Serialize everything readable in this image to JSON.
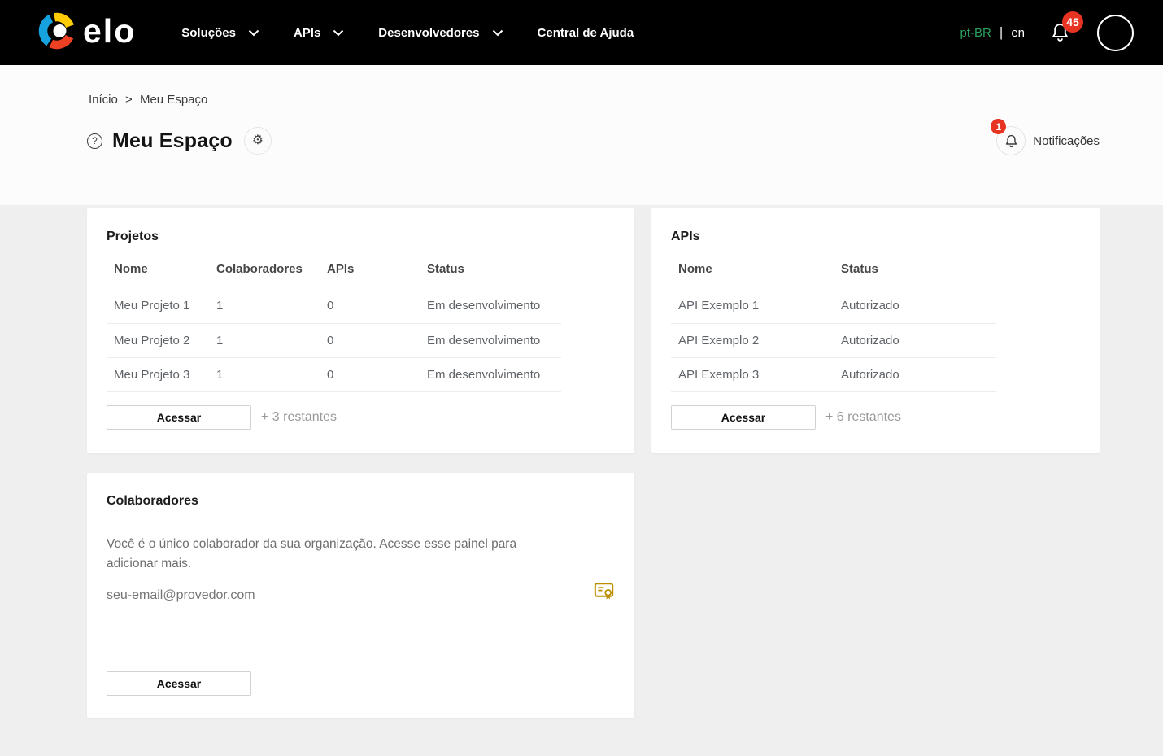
{
  "navbar": {
    "logo_text": "elo",
    "items": [
      {
        "label": "Soluções"
      },
      {
        "label": "APIs"
      },
      {
        "label": "Desenvolvedores"
      },
      {
        "label": "Central de Ajuda"
      }
    ],
    "language": {
      "current": "pt-BR",
      "separator": "|",
      "alternate": "en"
    },
    "notification_count": "45"
  },
  "breadcrumb": {
    "home": "Início",
    "separator": ">",
    "current": "Meu Espaço"
  },
  "page": {
    "title": "Meu Espaço",
    "help_glyph": "?",
    "gear_glyph": "⚙",
    "notifications_label": "Notificações",
    "notifications_badge": "1"
  },
  "projects_card": {
    "title": "Projetos",
    "columns": [
      "Nome",
      "Colaboradores",
      "APIs",
      "Status"
    ],
    "rows": [
      [
        "Meu Projeto 1",
        "1",
        "0",
        "Em desenvolvimento"
      ],
      [
        "Meu Projeto 2",
        "1",
        "0",
        "Em desenvolvimento"
      ],
      [
        "Meu Projeto 3",
        "1",
        "0",
        "Em desenvolvimento"
      ]
    ],
    "action_label": "Acessar",
    "remaining": "+ 3 restantes"
  },
  "apis_card": {
    "title": "APIs",
    "columns": [
      "Nome",
      "Status"
    ],
    "rows": [
      [
        "API Exemplo 1",
        "Autorizado"
      ],
      [
        "API Exemplo 2",
        "Autorizado"
      ],
      [
        "API Exemplo 3",
        "Autorizado"
      ]
    ],
    "action_label": "Acessar",
    "remaining": "+ 6 restantes"
  },
  "collaborators_card": {
    "title": "Colaboradores",
    "description": "Você é o único colaborador da sua organização. Acesse esse painel para adicionar mais.",
    "email_placeholder": "seu-email@provedor.com",
    "action_label": "Acessar"
  },
  "colors": {
    "accent_green": "#2ba35f",
    "badge_red": "#e63322",
    "gold": "#bd8d00",
    "logo_blue": "#16a2de",
    "logo_yellow": "#ffcb05",
    "logo_red": "#ee4023"
  }
}
